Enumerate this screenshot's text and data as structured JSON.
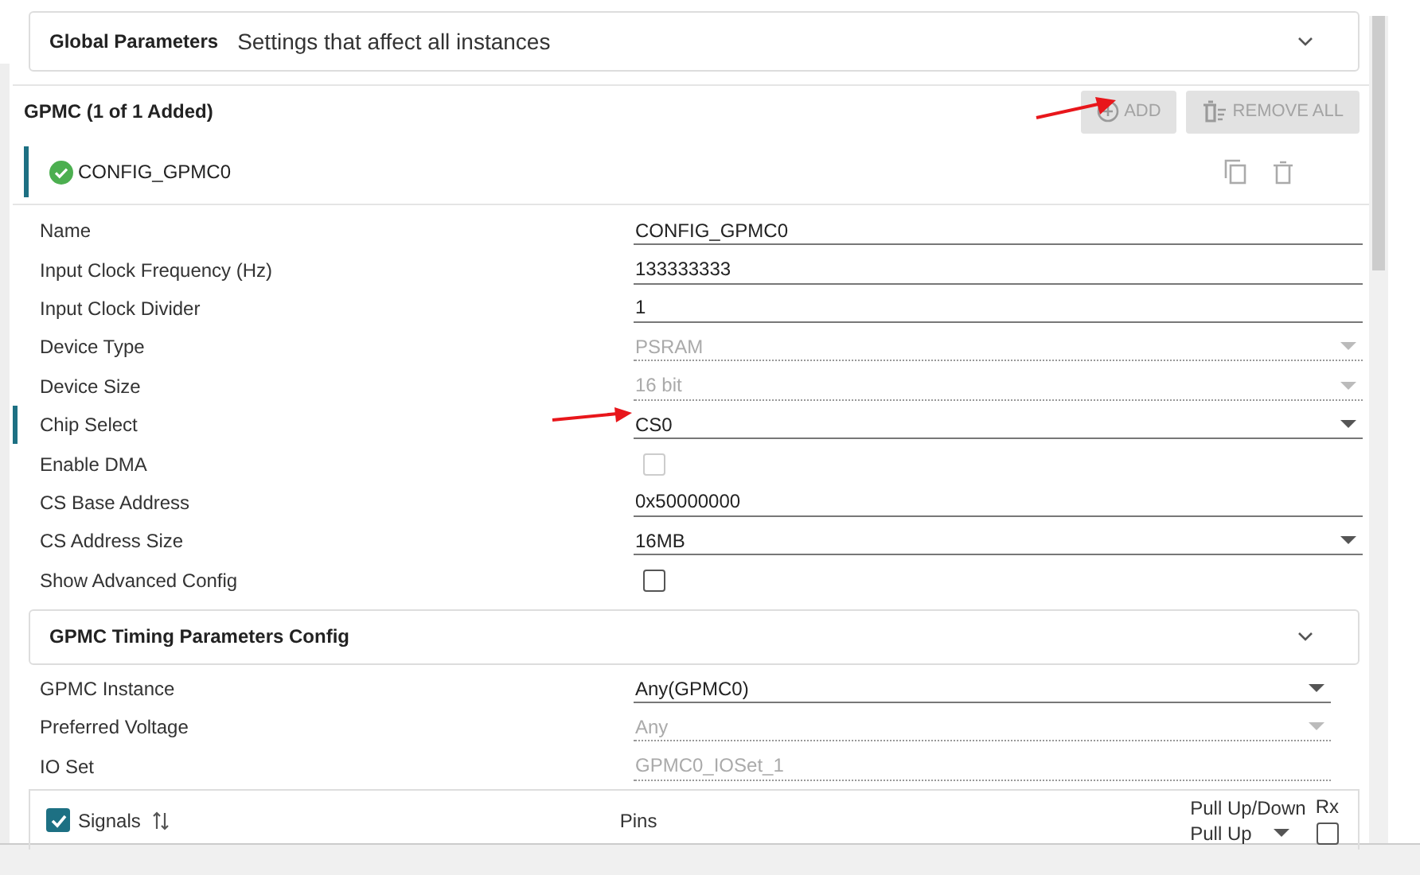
{
  "global_parameters": {
    "title": "Global Parameters",
    "description": "Settings that affect all instances",
    "expanded": false
  },
  "module": {
    "title": "GPMC (1 of 1 Added)",
    "buttons": [
      {
        "label": "ADD",
        "kind": "add",
        "disabled": true
      },
      {
        "label": "REMOVE ALL",
        "kind": "remove",
        "disabled": true
      }
    ]
  },
  "instances": [
    {
      "name": "CONFIG_GPMC0",
      "selected": true,
      "valid": true
    }
  ],
  "fields": [
    {
      "label": "Name",
      "kind": "text",
      "value": "CONFIG_GPMC0",
      "disabled": false,
      "highlighted": false
    },
    {
      "label": "Input Clock Frequency (Hz)",
      "kind": "text",
      "value": "133333333",
      "disabled": false,
      "highlighted": false
    },
    {
      "label": "Input Clock Divider",
      "kind": "text",
      "value": "1",
      "disabled": false,
      "highlighted": false
    },
    {
      "label": "Device Type",
      "kind": "select",
      "value": "PSRAM",
      "disabled": true,
      "highlighted": false
    },
    {
      "label": "Device Size",
      "kind": "select",
      "value": "16 bit",
      "disabled": true,
      "highlighted": false
    },
    {
      "label": "Chip Select",
      "kind": "select",
      "value": "CS0",
      "disabled": false,
      "highlighted": true
    },
    {
      "label": "Enable DMA",
      "kind": "checkbox",
      "checked": false,
      "disabled": true,
      "highlighted": false
    },
    {
      "label": "CS Base Address",
      "kind": "text",
      "value": "0x50000000",
      "disabled": false,
      "highlighted": false
    },
    {
      "label": "CS Address Size",
      "kind": "select",
      "value": "16MB",
      "disabled": false,
      "highlighted": false
    },
    {
      "label": "Show Advanced Config",
      "kind": "checkbox",
      "checked": false,
      "disabled": false,
      "highlighted": false
    }
  ],
  "timing_section": {
    "title": "GPMC Timing Parameters Config",
    "expanded": false
  },
  "pin_fields": [
    {
      "label": "GPMC Instance",
      "kind": "select",
      "value": "Any(GPMC0)",
      "disabled": false
    },
    {
      "label": "Preferred Voltage",
      "kind": "select",
      "value": "Any",
      "disabled": true
    },
    {
      "label": "IO Set",
      "kind": "text",
      "value": "GPMC0_IOSet_1",
      "disabled": true
    }
  ],
  "signals_table": {
    "all_checked": true,
    "columns": [
      "Signals",
      "Pins",
      "Pull Up/Down",
      "Rx"
    ],
    "pull": "Pull Up",
    "rx_checked": false
  }
}
